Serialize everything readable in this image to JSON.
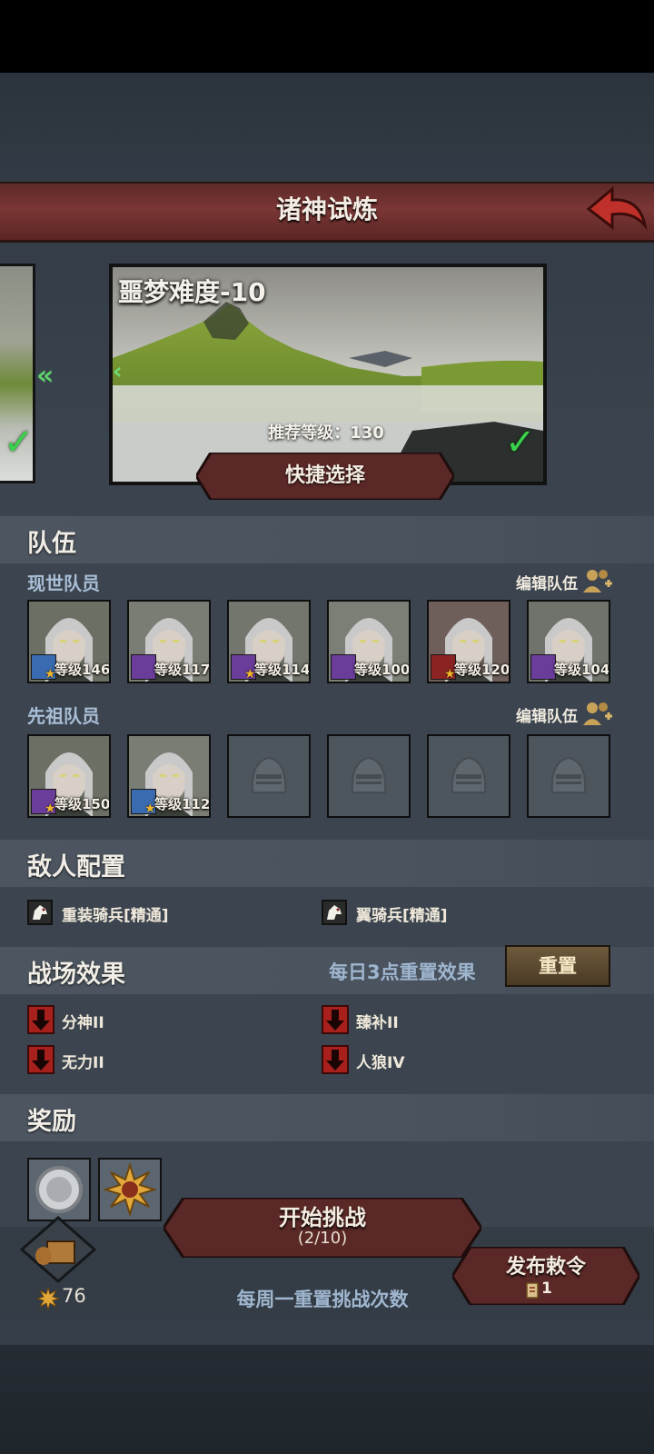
{
  "header": {
    "title": "诸神试炼"
  },
  "stage": {
    "title": "噩梦难度-10",
    "recommended": "推荐等级：130",
    "quick_select": "快捷选择",
    "prev_glyph": "«",
    "inner_prev_glyph": "‹",
    "check_glyph": "✓"
  },
  "team": {
    "section_title": "队伍",
    "current_label": "现世队员",
    "ancestor_label": "先祖队员",
    "edit_label": "编辑队伍",
    "current_members": [
      {
        "level": "等级146",
        "class_color": "blue",
        "star": true
      },
      {
        "level": "等级117",
        "class_color": "purple",
        "star": false
      },
      {
        "level": "等级114",
        "class_color": "purple",
        "star": true
      },
      {
        "level": "等级100",
        "class_color": "purple",
        "star": false
      },
      {
        "level": "等级120",
        "class_color": "red",
        "star": true
      },
      {
        "level": "等级104",
        "class_color": "purple",
        "star": false
      }
    ],
    "ancestor_members": [
      {
        "level": "等级150",
        "class_color": "purple",
        "star": true
      },
      {
        "level": "等级112",
        "class_color": "blue",
        "star": true
      }
    ]
  },
  "enemies": {
    "section_title": "敌人配置",
    "list": [
      "重装骑兵[精通]",
      "翼骑兵[精通]"
    ]
  },
  "battlefield": {
    "section_title": "战场效果",
    "reset_note": "每日3点重置效果",
    "reset_button": "重置",
    "effects": [
      "分神II",
      "臻补II",
      "无力II",
      "人狼IV"
    ]
  },
  "rewards": {
    "section_title": "奖励"
  },
  "bottom": {
    "start_label": "开始挑战",
    "start_count": "(2/10)",
    "weekly_note": "每周一重置挑战次数",
    "currency": "76",
    "decree_label": "发布敕令",
    "decree_count": "1"
  },
  "colors": {
    "accent_red": "#7a3634",
    "check_green": "#3bd24c",
    "debuff_red": "#a8201c"
  }
}
